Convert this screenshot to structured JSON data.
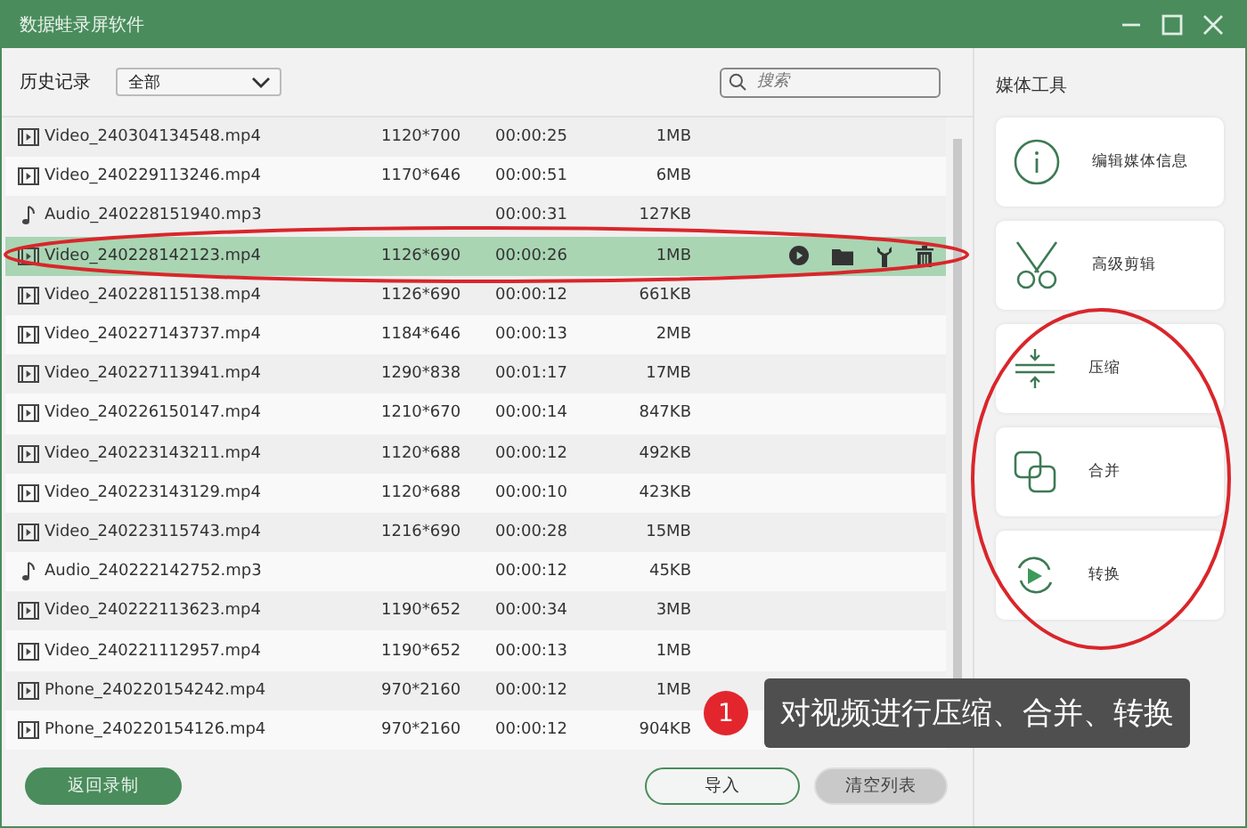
{
  "window": {
    "title": "数据蛙录屏软件"
  },
  "toolbar": {
    "label": "历史记录",
    "filter": "全部",
    "search_placeholder": "搜索"
  },
  "files": [
    {
      "kind": "video",
      "name": "Video_240304134548.mp4",
      "resolution": "1120*700",
      "duration": "00:00:25",
      "size": "1MB",
      "selected": false
    },
    {
      "kind": "video",
      "name": "Video_240229113246.mp4",
      "resolution": "1170*646",
      "duration": "00:00:51",
      "size": "6MB",
      "selected": false
    },
    {
      "kind": "audio",
      "name": "Audio_240228151940.mp3",
      "duration": "00:00:31",
      "size": "127KB",
      "selected": false
    },
    {
      "kind": "video",
      "name": "Video_240228142123.mp4",
      "resolution": "1126*690",
      "duration": "00:00:26",
      "size": "1MB",
      "selected": true
    },
    {
      "kind": "video",
      "name": "Video_240228115138.mp4",
      "resolution": "1126*690",
      "duration": "00:00:12",
      "size": "661KB",
      "selected": false
    },
    {
      "kind": "video",
      "name": "Video_240227143737.mp4",
      "resolution": "1184*646",
      "duration": "00:00:13",
      "size": "2MB",
      "selected": false
    },
    {
      "kind": "video",
      "name": "Video_240227113941.mp4",
      "resolution": "1290*838",
      "duration": "00:01:17",
      "size": "17MB",
      "selected": false
    },
    {
      "kind": "video",
      "name": "Video_240226150147.mp4",
      "resolution": "1210*670",
      "duration": "00:00:14",
      "size": "847KB",
      "selected": false
    },
    {
      "kind": "video",
      "name": "Video_240223143211.mp4",
      "resolution": "1120*688",
      "duration": "00:00:12",
      "size": "492KB",
      "selected": false
    },
    {
      "kind": "video",
      "name": "Video_240223143129.mp4",
      "resolution": "1120*688",
      "duration": "00:00:10",
      "size": "423KB",
      "selected": false
    },
    {
      "kind": "video",
      "name": "Video_240223115743.mp4",
      "resolution": "1216*690",
      "duration": "00:00:28",
      "size": "15MB",
      "selected": false
    },
    {
      "kind": "audio",
      "name": "Audio_240222142752.mp3",
      "duration": "00:00:12",
      "size": "45KB",
      "selected": false
    },
    {
      "kind": "video",
      "name": "Video_240222113623.mp4",
      "resolution": "1190*652",
      "duration": "00:00:34",
      "size": "3MB",
      "selected": false
    },
    {
      "kind": "video",
      "name": "Video_240221112957.mp4",
      "resolution": "1190*652",
      "duration": "00:00:13",
      "size": "1MB",
      "selected": false
    },
    {
      "kind": "video",
      "name": "Phone_240220154242.mp4",
      "resolution": "970*2160",
      "duration": "00:00:12",
      "size": "1MB",
      "selected": false
    },
    {
      "kind": "video",
      "name": "Phone_240220154126.mp4",
      "resolution": "970*2160",
      "duration": "00:00:12",
      "size": "904KB",
      "selected": false
    }
  ],
  "buttons": {
    "back": "返回录制",
    "import": "导入",
    "clear": "清空列表",
    "clear_disabled": true
  },
  "sidebar": {
    "title": "媒体工具",
    "tools": [
      {
        "kind": "info",
        "label": "编辑媒体信息"
      },
      {
        "kind": "cut",
        "label": "高级剪辑"
      },
      {
        "kind": "compress",
        "label": "压缩"
      },
      {
        "kind": "merge",
        "label": "合并"
      },
      {
        "kind": "convert",
        "label": "转换"
      }
    ]
  },
  "callout": {
    "number": "1",
    "text": "对视频进行压缩、合并、转换"
  }
}
